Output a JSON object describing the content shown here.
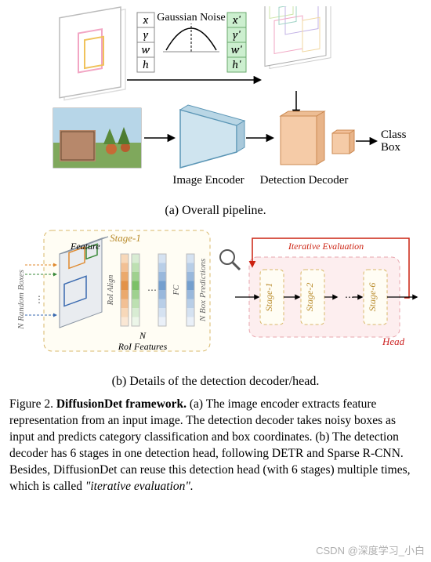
{
  "figure_a": {
    "gauss_label": "Gaussian Noise",
    "in_box": [
      "x",
      "y",
      "w",
      "h"
    ],
    "out_box": [
      "x'",
      "y'",
      "w'",
      "h'"
    ],
    "encoder_label": "Image Encoder",
    "decoder_label": "Detection Decoder",
    "out1": "Class",
    "out2": "Box",
    "caption": "(a) Overall pipeline."
  },
  "figure_b": {
    "stage1_label": "Stage-1",
    "feature_label": "Feature",
    "random_boxes_label": "N Random Boxes",
    "roi_align_label": "RoI Align",
    "fc_label": "FC",
    "box_pred_label": "N Box Predictions",
    "n_feat_label1": "N",
    "n_feat_label2": "RoI Features",
    "iter_eval_label": "Iterative Evaluation",
    "stages": [
      "Stage-1",
      "Stage-2",
      "Stage-6"
    ],
    "head_label": "Head",
    "caption": "(b) Details of the detection decoder/head."
  },
  "caption": {
    "lead": "Figure 2.",
    "bold_title": "DiffusionDet framework.",
    "body": " (a) The image encoder extracts feature representation from an input image. The detection decoder takes noisy boxes as input and predicts category classification and box coordinates. (b) The detection decoder has 6 stages in one detection head, following DETR and Sparse R-CNN. Besides, DiffusionDet can reuse this detection head (with 6 stages) multiple times, which is called",
    "italic": " \"iterative evaluation\"."
  },
  "watermark": "CSDN @深度学习_小白"
}
